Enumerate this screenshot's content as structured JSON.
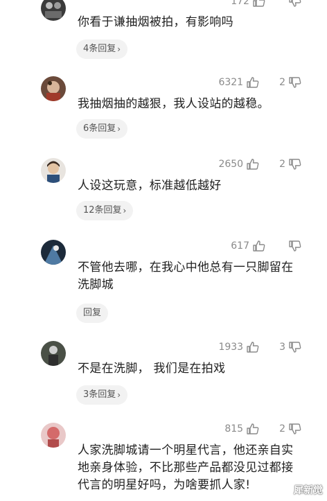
{
  "comments": [
    {
      "likes": "172",
      "dislikes": "",
      "text": "你看于谦抽烟被拍，有影响吗",
      "replies": "4条回复"
    },
    {
      "likes": "6321",
      "dislikes": "2",
      "text": "我抽烟抽的越狠，我人设站的越稳。",
      "replies": "6条回复"
    },
    {
      "likes": "2650",
      "dislikes": "2",
      "text": "人设这玩意，标准越低越好",
      "replies": "12条回复"
    },
    {
      "likes": "617",
      "dislikes": "",
      "text": "不管他去哪，在我心中他总有一只脚留在洗脚城",
      "replies": "回复"
    },
    {
      "likes": "1933",
      "dislikes": "3",
      "text": "不是在洗脚， 我们是在拍戏",
      "replies": "3条回复"
    },
    {
      "likes": "815",
      "dislikes": "2",
      "text": "人家洗脚城请一个明星代言，他还亲自实地亲身体验，不比那些产品都没见过都接代言的明星好吗，为啥要抓人家!",
      "replies": ""
    }
  ],
  "icons": {
    "like": "like-icon",
    "dislike": "dislike-icon",
    "chevron": "chevron-right-icon"
  },
  "chevron_glyph": "›",
  "watermark": "犀新觉"
}
